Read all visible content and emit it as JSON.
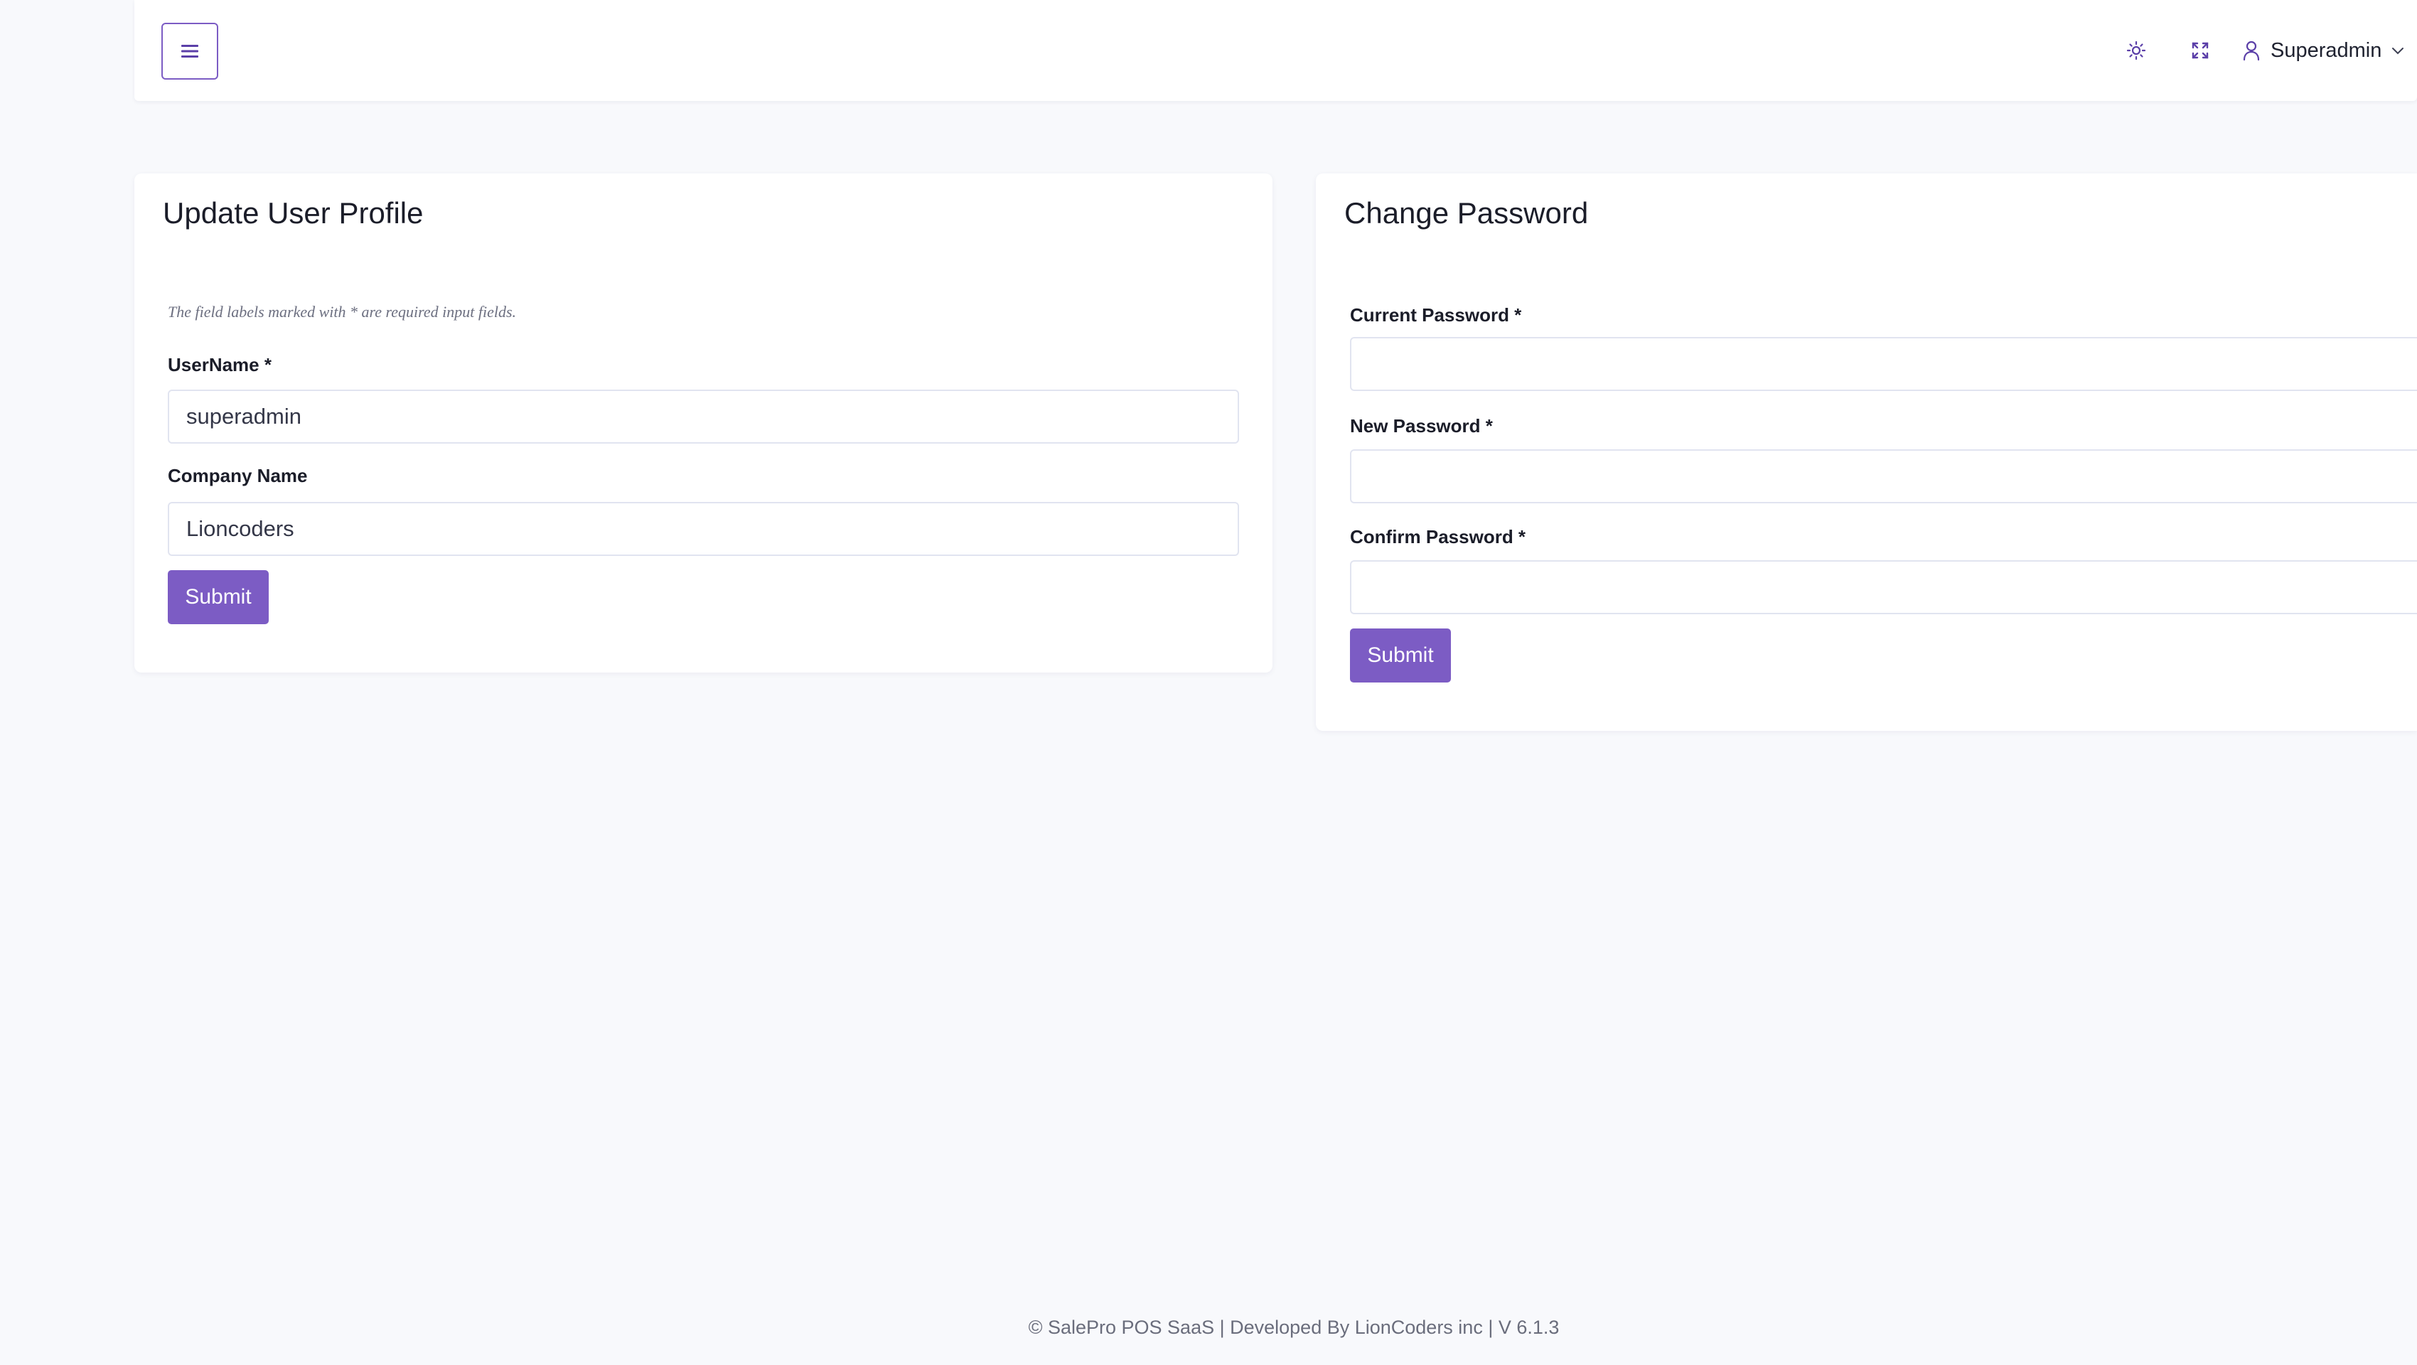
{
  "header": {
    "menu_icon": "hamburger-icon",
    "brightness_icon": "sun-icon",
    "fullscreen_icon": "expand-icon",
    "user_icon": "user-icon",
    "user_name": "Superadmin",
    "dropdown_icon": "chevron-down-icon"
  },
  "profile_card": {
    "title": "Update User Profile",
    "required_note": "The field labels marked with * are required input fields.",
    "username_label": "UserName *",
    "username_value": "superadmin",
    "company_label": "Company Name",
    "company_value": "Lioncoders",
    "submit_label": "Submit"
  },
  "password_card": {
    "title": "Change Password",
    "current_label": "Current Password *",
    "current_value": "",
    "new_label": "New Password *",
    "new_value": "",
    "confirm_label": "Confirm Password *",
    "confirm_value": "",
    "submit_label": "Submit"
  },
  "footer": {
    "text": "© SalePro POS SaaS | Developed By LionCoders inc | V 6.1.3"
  },
  "colors": {
    "accent": "#7c5cc4",
    "background": "#f8f9fc",
    "card": "#ffffff"
  }
}
